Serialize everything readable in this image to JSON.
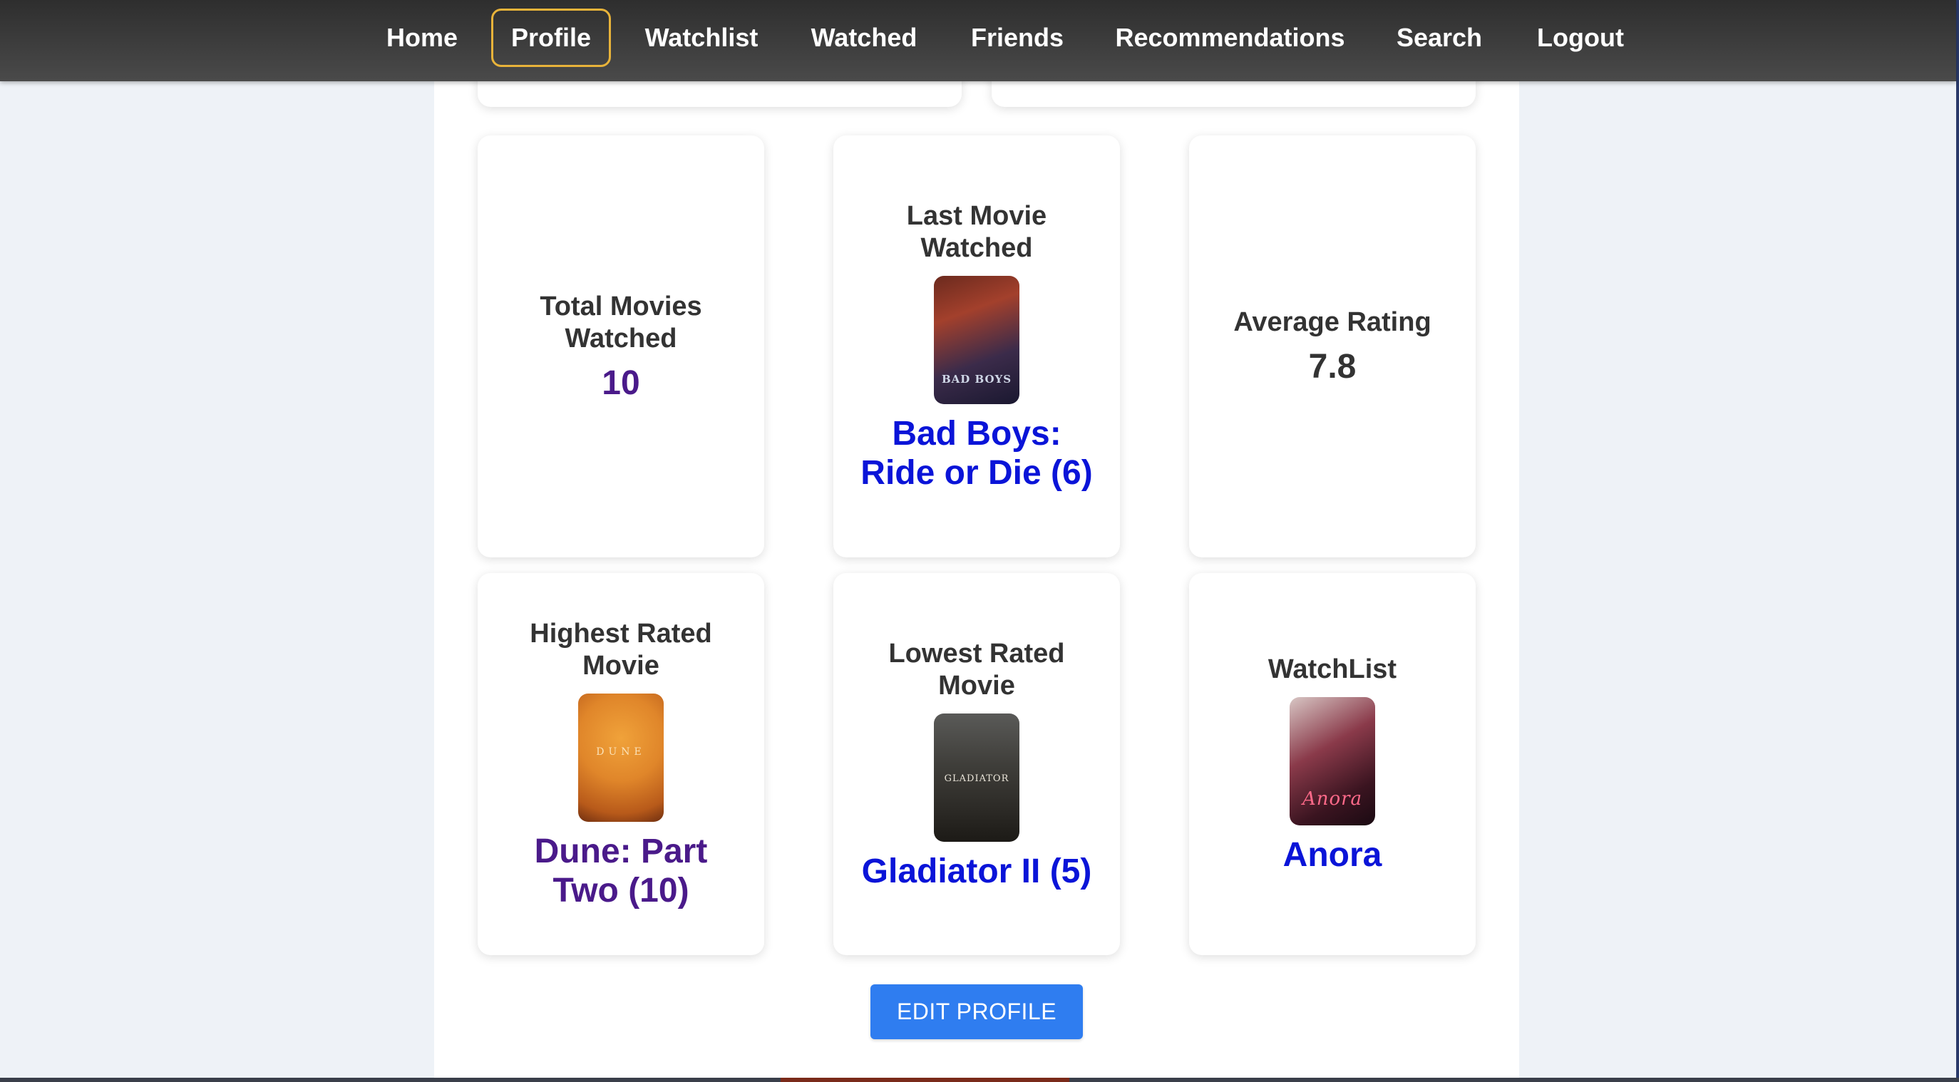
{
  "nav": {
    "items": [
      {
        "label": "Home",
        "active": false
      },
      {
        "label": "Profile",
        "active": true
      },
      {
        "label": "Watchlist",
        "active": false
      },
      {
        "label": "Watched",
        "active": false
      },
      {
        "label": "Friends",
        "active": false
      },
      {
        "label": "Recommendations",
        "active": false
      },
      {
        "label": "Search",
        "active": false
      },
      {
        "label": "Logout",
        "active": false
      }
    ]
  },
  "stats": {
    "total_movies": {
      "label": "Total Movies Watched",
      "value": "10"
    },
    "last_movie": {
      "label": "Last Movie Watched",
      "title": "Bad Boys: Ride or Die (6)",
      "poster_text": "BAD BOYS"
    },
    "average_rating": {
      "label": "Average Rating",
      "value": "7.8"
    },
    "highest_rated": {
      "label": "Highest Rated Movie",
      "title": "Dune: Part Two (10)",
      "poster_text": "DUNE"
    },
    "lowest_rated": {
      "label": "Lowest Rated Movie",
      "title": "Gladiator II (5)",
      "poster_text": "GLADIATOR"
    },
    "watchlist": {
      "label": "WatchList",
      "title": "Anora",
      "poster_text": "Anora"
    }
  },
  "edit_profile_label": "EDIT PROFILE",
  "colors": {
    "link_blue": "#0a14d8",
    "visited_purple": "#4a1a8a",
    "button_blue": "#2f7df0",
    "active_nav_border": "#e8b33a"
  }
}
